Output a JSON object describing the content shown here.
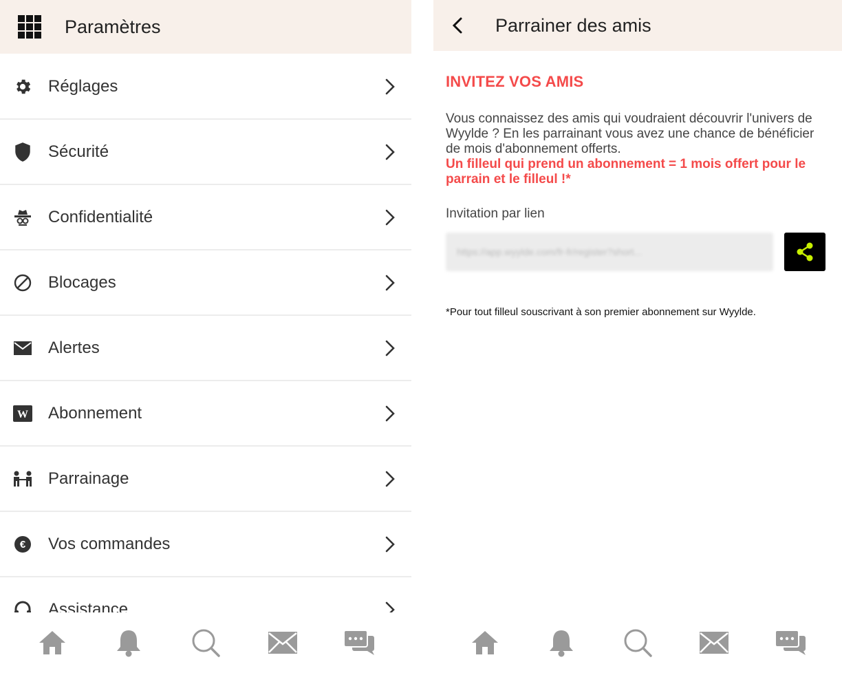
{
  "left_screen": {
    "header": {
      "title": "Paramètres",
      "menu_icon": "grid-menu-icon"
    },
    "menu_items": [
      {
        "label": "Réglages",
        "icon": "gear-icon"
      },
      {
        "label": "Sécurité",
        "icon": "shield-icon"
      },
      {
        "label": "Confidentialité",
        "icon": "spy-icon"
      },
      {
        "label": "Blocages",
        "icon": "block-icon"
      },
      {
        "label": "Alertes",
        "icon": "envelope-icon"
      },
      {
        "label": "Abonnement",
        "icon": "wyylde-logo-icon"
      },
      {
        "label": "Parrainage",
        "icon": "people-handshake-icon"
      },
      {
        "label": "Vos commandes",
        "icon": "euro-icon"
      },
      {
        "label": "Assistance",
        "icon": "headset-icon"
      }
    ]
  },
  "right_screen": {
    "header": {
      "title": "Parrainer des amis",
      "back_icon": "chevron-left-icon"
    },
    "heading": "INVITEZ VOS AMIS",
    "description": "Vous connaissez des amis qui voudraient découvrir l'univers de Wyylde ? En les parrainant vous avez une chance de bénéficier de mois d'abonnement offerts.",
    "highlight": "Un filleul qui prend un abonnement = 1 mois offert pour le parrain et le filleul !*",
    "link_label": "Invitation par lien",
    "link_value": "https://app.wyylde.com/fr-fr/register?short...",
    "footnote": "*Pour tout filleul souscrivant à son premier abonnement sur Wyylde."
  },
  "bottom_nav": [
    "home-icon",
    "bell-icon",
    "search-icon",
    "mail-icon",
    "chat-icon"
  ],
  "colors": {
    "header_bg": "#f8f0ea",
    "accent_red": "#f44a4a",
    "share_icon": "#c8f000",
    "icon_gray": "#9a9a9a"
  }
}
